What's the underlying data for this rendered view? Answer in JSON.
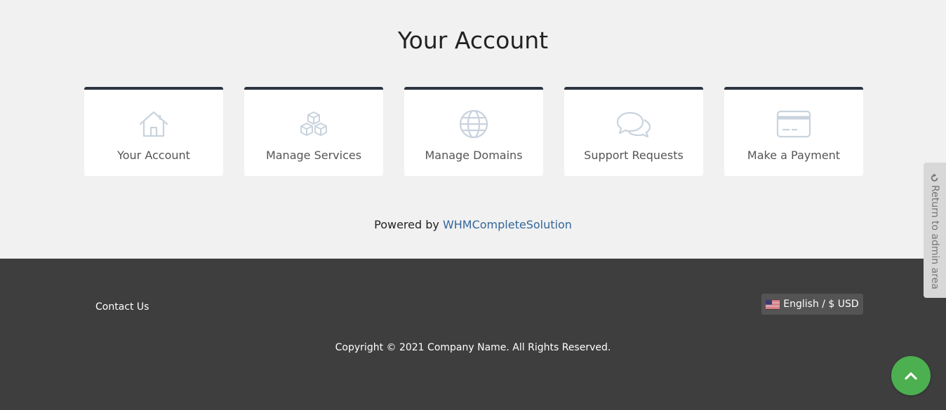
{
  "page": {
    "title": "Your Account"
  },
  "tiles": [
    {
      "label": "Your Account",
      "icon": "home-icon"
    },
    {
      "label": "Manage Services",
      "icon": "cubes-icon"
    },
    {
      "label": "Manage Domains",
      "icon": "globe-icon"
    },
    {
      "label": "Support Requests",
      "icon": "chat-bubbles-icon"
    },
    {
      "label": "Make a Payment",
      "icon": "credit-card-icon"
    }
  ],
  "powered": {
    "prefix": "Powered by ",
    "link_text": "WHMCompleteSolution"
  },
  "footer": {
    "contact_label": "Contact Us",
    "language_label": "English / $ USD",
    "copyright": "Copyright © 2021 Company Name. All Rights Reserved."
  },
  "admin_tab": {
    "label": "Return to admin area"
  },
  "colors": {
    "tile_border": "#2b3440",
    "icon_stroke": "#c9d3dd",
    "link": "#336699",
    "footer_bg": "#3e3e3e",
    "back_to_top": "#4caf50"
  }
}
